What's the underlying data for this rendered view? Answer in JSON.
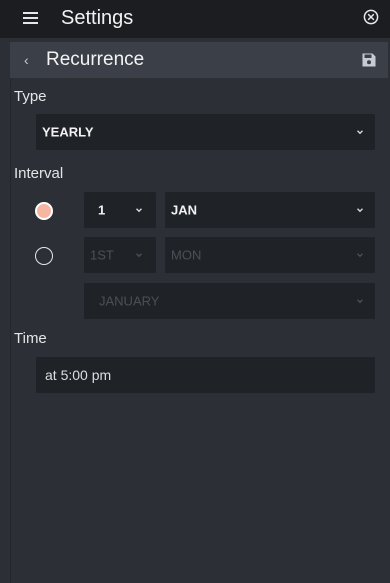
{
  "appbar": {
    "title": "Settings",
    "menu_icon": "hamburger-menu-icon",
    "close_icon": "close-circle-icon"
  },
  "subheader": {
    "title": "Recurrence",
    "back_icon": "chevron-left-icon",
    "save_icon": "floppy-disk-icon"
  },
  "type_section": {
    "label": "Type",
    "selected": "YEARLY"
  },
  "interval_section": {
    "label": "Interval",
    "option_1": {
      "selected": true,
      "day": "1",
      "month": "JAN"
    },
    "option_2": {
      "selected": false,
      "ordinal": "1ST",
      "weekday": "MON",
      "month": "JANUARY"
    }
  },
  "time_section": {
    "label": "Time",
    "value": "at 5:00 pm"
  },
  "colors": {
    "accent": "#f6b6a2",
    "appbar_bg": "#1b1d21",
    "panel_bg": "#2c3036",
    "field_bg": "#1f2227"
  }
}
